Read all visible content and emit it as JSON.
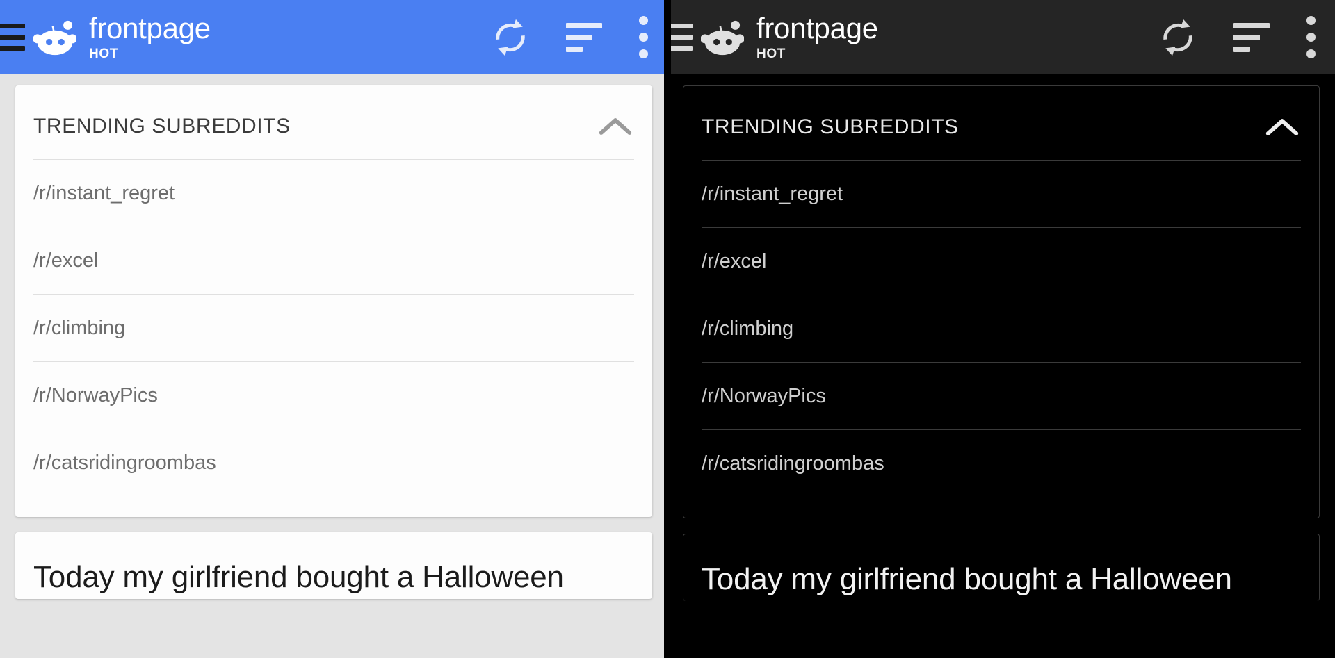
{
  "panels": [
    {
      "theme_name": "light",
      "accent_color": "#4a7ff2",
      "background_color": "#e4e4e4",
      "card_color": "#fdfdfd",
      "header": {
        "menu_icon": "hamburger-icon",
        "logo_icon": "reddit-snoo-icon",
        "title": "frontpage",
        "subtitle": "HOT",
        "refresh_icon": "refresh-icon",
        "sort_icon": "sort-icon",
        "overflow_icon": "more-vertical-icon"
      },
      "trending": {
        "heading": "TRENDING SUBREDDITS",
        "collapse_icon": "chevron-up-icon",
        "items": [
          "/r/instant_regret",
          "/r/excel",
          "/r/climbing",
          "/r/NorwayPics",
          "/r/catsridingroombas"
        ]
      },
      "post": {
        "title": "Today my girlfriend bought a Halloween"
      }
    },
    {
      "theme_name": "dark",
      "accent_color": "#252525",
      "background_color": "#000000",
      "card_color": "#000000",
      "header": {
        "menu_icon": "hamburger-icon",
        "logo_icon": "reddit-snoo-icon",
        "title": "frontpage",
        "subtitle": "HOT",
        "refresh_icon": "refresh-icon",
        "sort_icon": "sort-icon",
        "overflow_icon": "more-vertical-icon"
      },
      "trending": {
        "heading": "TRENDING SUBREDDITS",
        "collapse_icon": "chevron-up-icon",
        "items": [
          "/r/instant_regret",
          "/r/excel",
          "/r/climbing",
          "/r/NorwayPics",
          "/r/catsridingroombas"
        ]
      },
      "post": {
        "title": "Today my girlfriend bought a Halloween"
      }
    }
  ]
}
